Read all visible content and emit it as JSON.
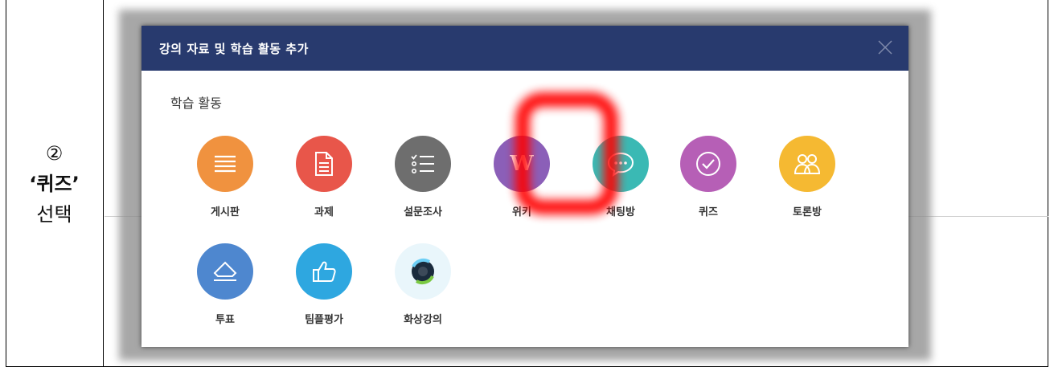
{
  "instruction": {
    "step_number": "②",
    "step_target": "‘퀴즈’",
    "step_action": "선택"
  },
  "dialog": {
    "title": "강의 자료 및 학습 활동 추가",
    "section_title": "학습 활동",
    "activities": [
      {
        "label": "게시판",
        "icon": "list-icon",
        "color": "#f0923f"
      },
      {
        "label": "과제",
        "icon": "document-icon",
        "color": "#e8564a"
      },
      {
        "label": "설문조사",
        "icon": "checklist-icon",
        "color": "#6e6e6e"
      },
      {
        "label": "위키",
        "icon": "wiki-icon",
        "color": "#8b5fb8"
      },
      {
        "label": "채팅방",
        "icon": "chat-bubble-icon",
        "color": "#3ab9b4"
      },
      {
        "label": "퀴즈",
        "icon": "check-circle-icon",
        "color": "#b65fb6"
      },
      {
        "label": "토론방",
        "icon": "people-icon",
        "color": "#f5b932"
      },
      {
        "label": "투표",
        "icon": "eraser-icon",
        "color": "#4e87cf"
      },
      {
        "label": "팀플평가",
        "icon": "thumbs-up-icon",
        "color": "#2ea7e0"
      },
      {
        "label": "화상강의",
        "icon": "webex-icon",
        "color": "#e9f6fb"
      }
    ]
  }
}
